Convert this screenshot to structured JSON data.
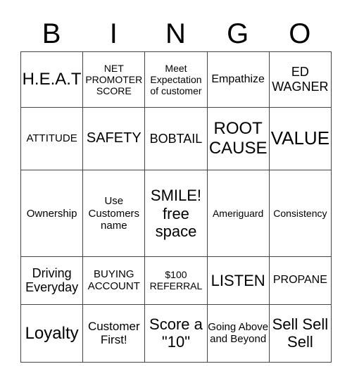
{
  "header": [
    "B",
    "I",
    "N",
    "G",
    "O"
  ],
  "rows": [
    [
      {
        "t": "H.E.A.T",
        "s": 24
      },
      {
        "t": "NET PROMOTER SCORE",
        "s": 14
      },
      {
        "t": "Meet Expectation of customer",
        "s": 14
      },
      {
        "t": "Empathize",
        "s": 16
      },
      {
        "t": "ED WAGNER",
        "s": 18
      }
    ],
    [
      {
        "t": "ATTITUDE",
        "s": 15
      },
      {
        "t": "SAFETY",
        "s": 20
      },
      {
        "t": "BOBTAIL",
        "s": 18
      },
      {
        "t": "ROOT CAUSE",
        "s": 24
      },
      {
        "t": "VALUE",
        "s": 26
      }
    ],
    [
      {
        "t": "Ownership",
        "s": 15
      },
      {
        "t": "Use Customers name",
        "s": 15
      },
      {
        "t": "SMILE! free space",
        "s": 22
      },
      {
        "t": "Ameriguard",
        "s": 14
      },
      {
        "t": "Consistency",
        "s": 14
      }
    ],
    [
      {
        "t": "Driving Everyday",
        "s": 18
      },
      {
        "t": "BUYING ACCOUNT",
        "s": 15
      },
      {
        "t": "$100 REFERRAL",
        "s": 14
      },
      {
        "t": "LISTEN",
        "s": 22
      },
      {
        "t": "PROPANE",
        "s": 16
      }
    ],
    [
      {
        "t": "Loyalty",
        "s": 24
      },
      {
        "t": "Customer First!",
        "s": 17
      },
      {
        "t": "Score a \"10\"",
        "s": 22
      },
      {
        "t": "Going Above and Beyond",
        "s": 15
      },
      {
        "t": "Sell Sell Sell",
        "s": 22
      }
    ]
  ]
}
